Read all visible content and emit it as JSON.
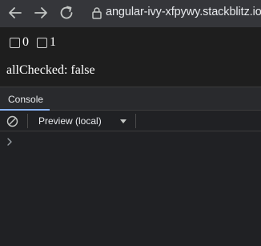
{
  "browser": {
    "url": "angular-ivy-xfpywy.stackblitz.io",
    "icons": {
      "back": "back-arrow-icon",
      "forward": "forward-arrow-icon",
      "reload": "reload-icon",
      "secure": "lock-icon"
    }
  },
  "app": {
    "checkboxes": [
      {
        "label": "0",
        "checked": false
      },
      {
        "label": "1",
        "checked": false
      }
    ],
    "status_text": "allChecked: false"
  },
  "devtools": {
    "tabs": [
      {
        "label": "Console",
        "active": true
      }
    ],
    "context_select": {
      "value": "Preview (local)"
    },
    "icons": {
      "clear": "clear-console-icon",
      "dropdown": "chevron-down-icon",
      "prompt": "chevron-right-icon"
    },
    "colors": {
      "accent": "#8ab4f8"
    }
  }
}
